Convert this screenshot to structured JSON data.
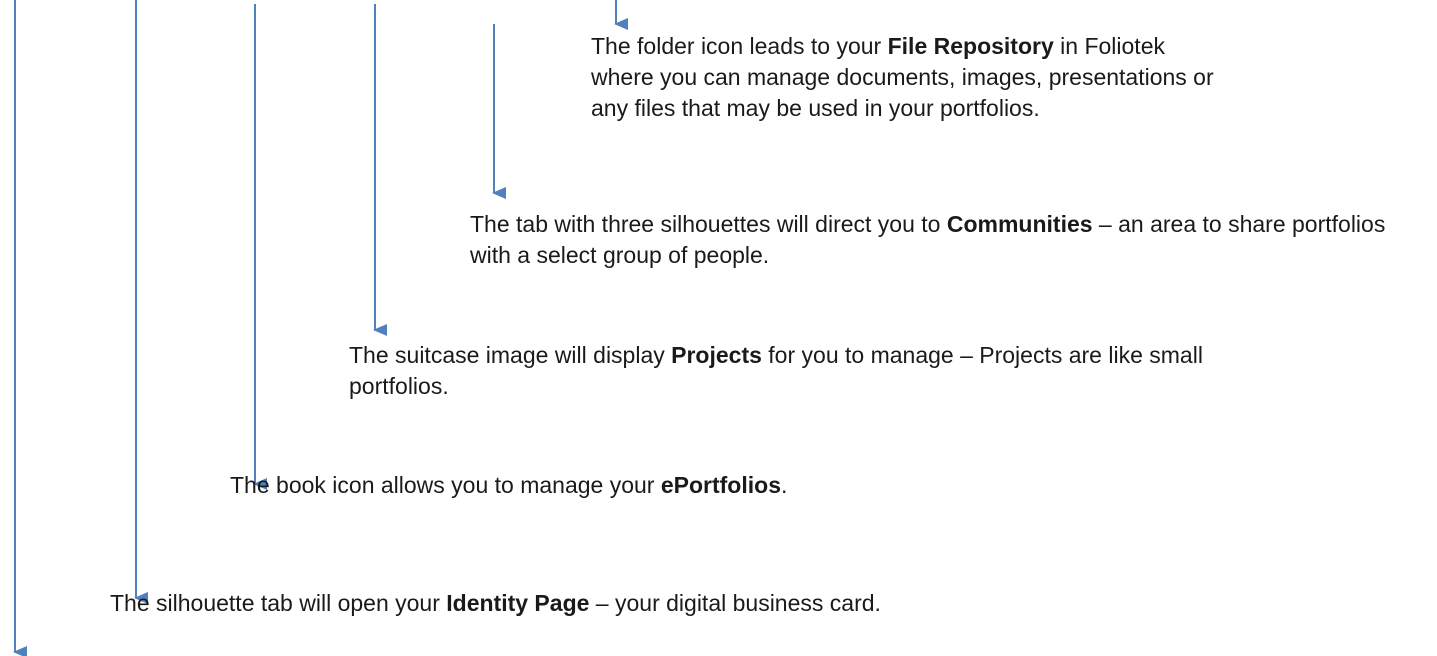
{
  "colors": {
    "arrow": "#4f81bd",
    "text": "#1a1a1a"
  },
  "annotations": [
    {
      "target": "file-repository",
      "before": "The folder icon leads to your ",
      "term": "File Repository",
      "after": " in Foliotek where you can manage documents, images, presentations or any files that may be used in your portfolios."
    },
    {
      "target": "communities",
      "before": "The tab with three silhouettes will direct you to ",
      "term": "Communities",
      "after": " – an area to share portfolios with a select group of people."
    },
    {
      "target": "projects",
      "before": "The suitcase image will display ",
      "term": "Projects",
      "after": " for you to manage – Projects are like small portfolios."
    },
    {
      "target": "eportfolios",
      "before": "The book icon allows you to manage your ",
      "term": "ePortfolios",
      "after": "."
    },
    {
      "target": "identity-page",
      "before": "The silhouette tab will open your ",
      "term": "Identity Page",
      "after": " – your digital business card."
    }
  ]
}
